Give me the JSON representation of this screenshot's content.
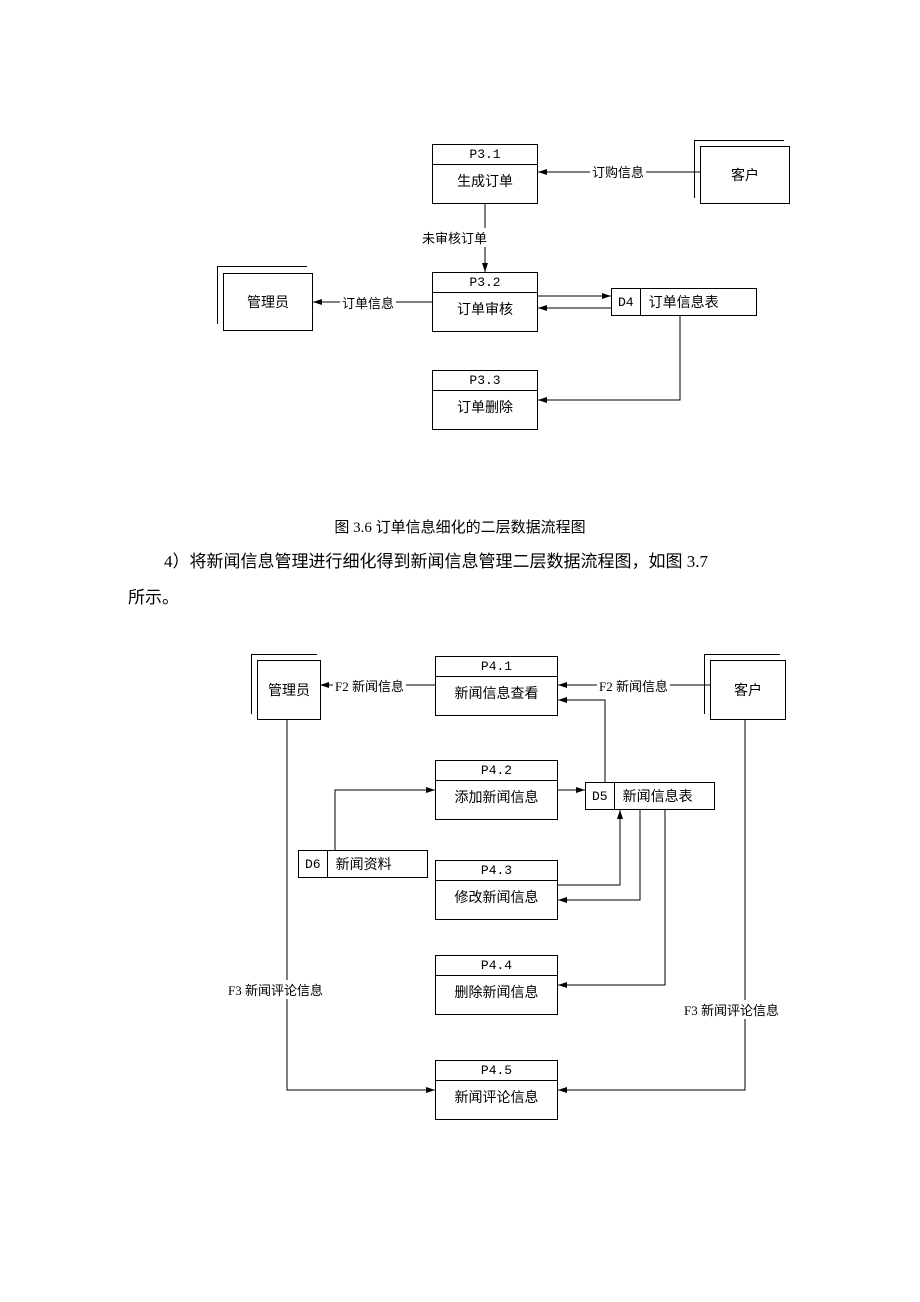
{
  "diagram1": {
    "entities": {
      "customer": "客户",
      "admin": "管理员"
    },
    "processes": {
      "p31": {
        "code": "P3.1",
        "name": "生成订单"
      },
      "p32": {
        "code": "P3.2",
        "name": "订单审核"
      },
      "p33": {
        "code": "P3.3",
        "name": "订单删除"
      }
    },
    "datastores": {
      "d4": {
        "code": "D4",
        "name": "订单信息表"
      }
    },
    "flows": {
      "order_info_in": "订购信息",
      "unreviewed": "未审核订单",
      "order_info_out": "订单信息"
    },
    "caption": "图 3.6  订单信息细化的二层数据流程图"
  },
  "bodytext": {
    "line1": "4）将新闻信息管理进行细化得到新闻信息管理二层数据流程图，如图 3.7",
    "line2": "所示。"
  },
  "diagram2": {
    "entities": {
      "admin": "管理员",
      "customer": "客户"
    },
    "processes": {
      "p41": {
        "code": "P4.1",
        "name": "新闻信息查看"
      },
      "p42": {
        "code": "P4.2",
        "name": "添加新闻信息"
      },
      "p43": {
        "code": "P4.3",
        "name": "修改新闻信息"
      },
      "p44": {
        "code": "P4.4",
        "name": "删除新闻信息"
      },
      "p45": {
        "code": "P4.5",
        "name": "新闻评论信息"
      }
    },
    "datastores": {
      "d5": {
        "code": "D5",
        "name": "新闻信息表"
      },
      "d6": {
        "code": "D6",
        "name": "新闻资料"
      }
    },
    "flows": {
      "f2a": "F2 新闻信息",
      "f2b": "F2 新闻信息",
      "f3a": "F3 新闻评论信息",
      "f3b": "F3 新闻评论信息"
    }
  }
}
